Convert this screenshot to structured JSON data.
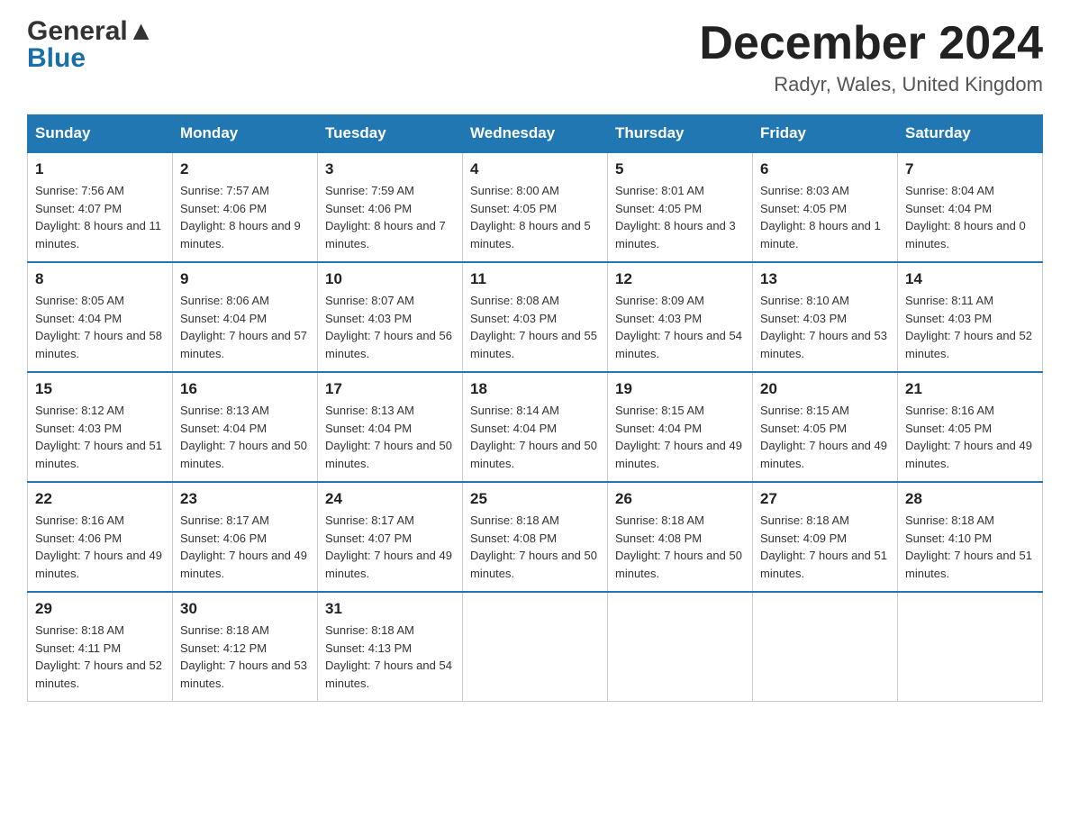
{
  "header": {
    "logo_general": "General",
    "logo_blue": "Blue",
    "month_title": "December 2024",
    "location": "Radyr, Wales, United Kingdom"
  },
  "days_of_week": [
    "Sunday",
    "Monday",
    "Tuesday",
    "Wednesday",
    "Thursday",
    "Friday",
    "Saturday"
  ],
  "weeks": [
    [
      {
        "num": "1",
        "sunrise": "Sunrise: 7:56 AM",
        "sunset": "Sunset: 4:07 PM",
        "daylight": "Daylight: 8 hours and 11 minutes."
      },
      {
        "num": "2",
        "sunrise": "Sunrise: 7:57 AM",
        "sunset": "Sunset: 4:06 PM",
        "daylight": "Daylight: 8 hours and 9 minutes."
      },
      {
        "num": "3",
        "sunrise": "Sunrise: 7:59 AM",
        "sunset": "Sunset: 4:06 PM",
        "daylight": "Daylight: 8 hours and 7 minutes."
      },
      {
        "num": "4",
        "sunrise": "Sunrise: 8:00 AM",
        "sunset": "Sunset: 4:05 PM",
        "daylight": "Daylight: 8 hours and 5 minutes."
      },
      {
        "num": "5",
        "sunrise": "Sunrise: 8:01 AM",
        "sunset": "Sunset: 4:05 PM",
        "daylight": "Daylight: 8 hours and 3 minutes."
      },
      {
        "num": "6",
        "sunrise": "Sunrise: 8:03 AM",
        "sunset": "Sunset: 4:05 PM",
        "daylight": "Daylight: 8 hours and 1 minute."
      },
      {
        "num": "7",
        "sunrise": "Sunrise: 8:04 AM",
        "sunset": "Sunset: 4:04 PM",
        "daylight": "Daylight: 8 hours and 0 minutes."
      }
    ],
    [
      {
        "num": "8",
        "sunrise": "Sunrise: 8:05 AM",
        "sunset": "Sunset: 4:04 PM",
        "daylight": "Daylight: 7 hours and 58 minutes."
      },
      {
        "num": "9",
        "sunrise": "Sunrise: 8:06 AM",
        "sunset": "Sunset: 4:04 PM",
        "daylight": "Daylight: 7 hours and 57 minutes."
      },
      {
        "num": "10",
        "sunrise": "Sunrise: 8:07 AM",
        "sunset": "Sunset: 4:03 PM",
        "daylight": "Daylight: 7 hours and 56 minutes."
      },
      {
        "num": "11",
        "sunrise": "Sunrise: 8:08 AM",
        "sunset": "Sunset: 4:03 PM",
        "daylight": "Daylight: 7 hours and 55 minutes."
      },
      {
        "num": "12",
        "sunrise": "Sunrise: 8:09 AM",
        "sunset": "Sunset: 4:03 PM",
        "daylight": "Daylight: 7 hours and 54 minutes."
      },
      {
        "num": "13",
        "sunrise": "Sunrise: 8:10 AM",
        "sunset": "Sunset: 4:03 PM",
        "daylight": "Daylight: 7 hours and 53 minutes."
      },
      {
        "num": "14",
        "sunrise": "Sunrise: 8:11 AM",
        "sunset": "Sunset: 4:03 PM",
        "daylight": "Daylight: 7 hours and 52 minutes."
      }
    ],
    [
      {
        "num": "15",
        "sunrise": "Sunrise: 8:12 AM",
        "sunset": "Sunset: 4:03 PM",
        "daylight": "Daylight: 7 hours and 51 minutes."
      },
      {
        "num": "16",
        "sunrise": "Sunrise: 8:13 AM",
        "sunset": "Sunset: 4:04 PM",
        "daylight": "Daylight: 7 hours and 50 minutes."
      },
      {
        "num": "17",
        "sunrise": "Sunrise: 8:13 AM",
        "sunset": "Sunset: 4:04 PM",
        "daylight": "Daylight: 7 hours and 50 minutes."
      },
      {
        "num": "18",
        "sunrise": "Sunrise: 8:14 AM",
        "sunset": "Sunset: 4:04 PM",
        "daylight": "Daylight: 7 hours and 50 minutes."
      },
      {
        "num": "19",
        "sunrise": "Sunrise: 8:15 AM",
        "sunset": "Sunset: 4:04 PM",
        "daylight": "Daylight: 7 hours and 49 minutes."
      },
      {
        "num": "20",
        "sunrise": "Sunrise: 8:15 AM",
        "sunset": "Sunset: 4:05 PM",
        "daylight": "Daylight: 7 hours and 49 minutes."
      },
      {
        "num": "21",
        "sunrise": "Sunrise: 8:16 AM",
        "sunset": "Sunset: 4:05 PM",
        "daylight": "Daylight: 7 hours and 49 minutes."
      }
    ],
    [
      {
        "num": "22",
        "sunrise": "Sunrise: 8:16 AM",
        "sunset": "Sunset: 4:06 PM",
        "daylight": "Daylight: 7 hours and 49 minutes."
      },
      {
        "num": "23",
        "sunrise": "Sunrise: 8:17 AM",
        "sunset": "Sunset: 4:06 PM",
        "daylight": "Daylight: 7 hours and 49 minutes."
      },
      {
        "num": "24",
        "sunrise": "Sunrise: 8:17 AM",
        "sunset": "Sunset: 4:07 PM",
        "daylight": "Daylight: 7 hours and 49 minutes."
      },
      {
        "num": "25",
        "sunrise": "Sunrise: 8:18 AM",
        "sunset": "Sunset: 4:08 PM",
        "daylight": "Daylight: 7 hours and 50 minutes."
      },
      {
        "num": "26",
        "sunrise": "Sunrise: 8:18 AM",
        "sunset": "Sunset: 4:08 PM",
        "daylight": "Daylight: 7 hours and 50 minutes."
      },
      {
        "num": "27",
        "sunrise": "Sunrise: 8:18 AM",
        "sunset": "Sunset: 4:09 PM",
        "daylight": "Daylight: 7 hours and 51 minutes."
      },
      {
        "num": "28",
        "sunrise": "Sunrise: 8:18 AM",
        "sunset": "Sunset: 4:10 PM",
        "daylight": "Daylight: 7 hours and 51 minutes."
      }
    ],
    [
      {
        "num": "29",
        "sunrise": "Sunrise: 8:18 AM",
        "sunset": "Sunset: 4:11 PM",
        "daylight": "Daylight: 7 hours and 52 minutes."
      },
      {
        "num": "30",
        "sunrise": "Sunrise: 8:18 AM",
        "sunset": "Sunset: 4:12 PM",
        "daylight": "Daylight: 7 hours and 53 minutes."
      },
      {
        "num": "31",
        "sunrise": "Sunrise: 8:18 AM",
        "sunset": "Sunset: 4:13 PM",
        "daylight": "Daylight: 7 hours and 54 minutes."
      },
      null,
      null,
      null,
      null
    ]
  ]
}
